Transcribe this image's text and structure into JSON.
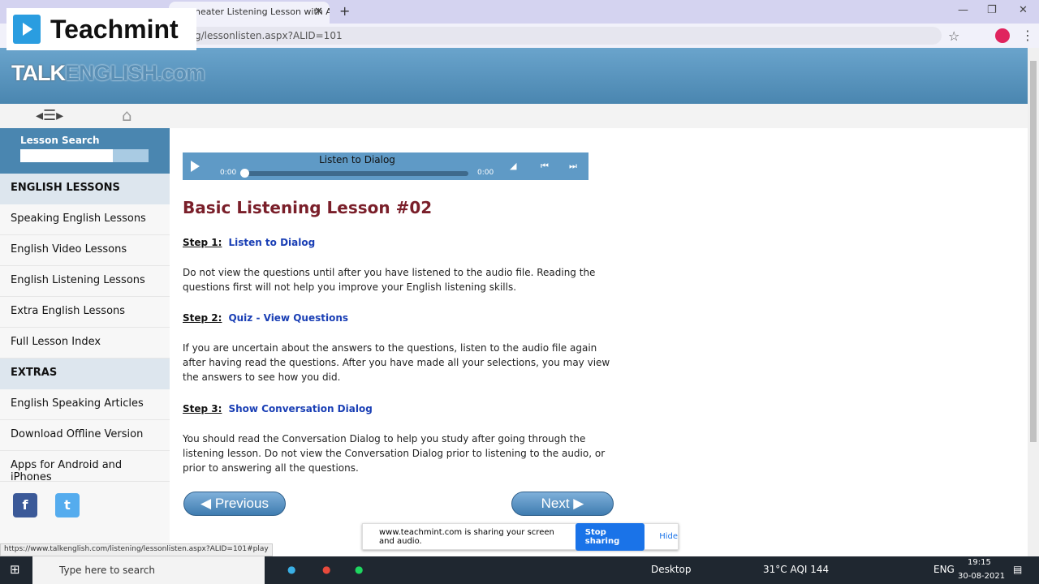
{
  "browser": {
    "tab_title": "heater Listening Lesson with Au",
    "new_tab": "+",
    "close": "✕",
    "url": "g/lessonlisten.aspx?ALID=101",
    "min": "—",
    "max": "❐",
    "win_close": "✕"
  },
  "overlay": {
    "brand": "Teachmint"
  },
  "site": {
    "logo_a": "TALK",
    "logo_b": "ENGLISH.com"
  },
  "sidebar": {
    "search_label": "Lesson Search",
    "sections": [
      {
        "title": "ENGLISH LESSONS",
        "items": [
          "Speaking English Lessons",
          "English Video Lessons",
          "English Listening Lessons",
          "Extra English Lessons",
          "Full Lesson Index"
        ]
      },
      {
        "title": "EXTRAS",
        "items": [
          "English Speaking Articles",
          "Download Offline Version",
          "Apps for Android and iPhones"
        ]
      }
    ]
  },
  "player": {
    "title": "Listen to Dialog",
    "current": "0:00",
    "duration": "0:00",
    "progress": 0
  },
  "lesson": {
    "title": "Basic Listening Lesson #02",
    "steps": [
      {
        "label": "Step 1:",
        "link": "Listen to Dialog",
        "text": "Do not view the questions until after you have listened to the audio file. Reading the questions first will not help you improve your English listening skills."
      },
      {
        "label": "Step 2:",
        "link": "Quiz - View Questions",
        "text": "If you are uncertain about the answers to the questions, listen to the audio file again after having read the questions. After you have made all your selections, you may view the answers to see how you did."
      },
      {
        "label": "Step 3:",
        "link": "Show Conversation Dialog",
        "text": "You should read the Conversation Dialog to help you study after going through the listening lesson. Do not view the Conversation Dialog prior to listening to the audio, or prior to answering all the questions."
      }
    ],
    "prev": "Previous",
    "next": "Next"
  },
  "status_url": "https://www.talkenglish.com/listening/lessonlisten.aspx?ALID=101#play",
  "share": {
    "text": "www.teachmint.com is sharing your screen and audio.",
    "stop": "Stop sharing",
    "hide": "Hide"
  },
  "taskbar": {
    "search": "Type here to search",
    "desktop": "Desktop",
    "weather": "31°C  AQI 144",
    "lang": "ENG",
    "time": "19:15",
    "date": "30-08-2021"
  }
}
